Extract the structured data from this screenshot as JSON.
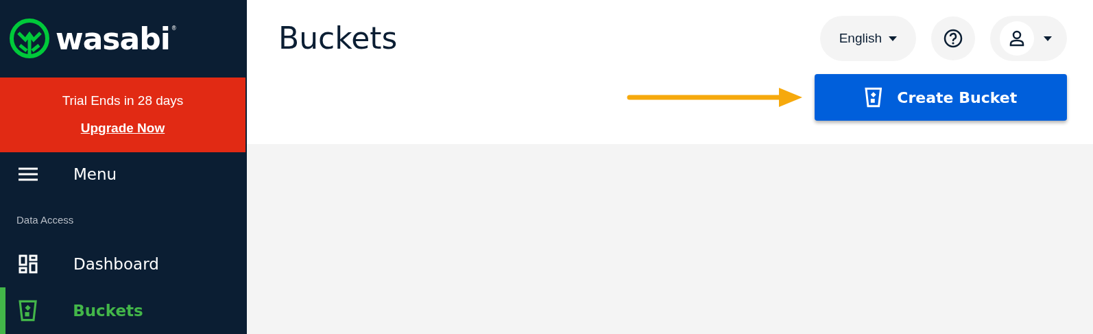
{
  "sidebar": {
    "logo": {
      "name": "wasabi",
      "mark": "®"
    },
    "trial_banner": {
      "message": "Trial Ends in 28 days",
      "link": "Upgrade Now"
    },
    "menu_label": "Menu",
    "section": "Data Access",
    "items": [
      {
        "label": "Dashboard",
        "kind": "dashboard",
        "selected": false
      },
      {
        "label": "Buckets",
        "kind": "bucket",
        "selected": true
      }
    ]
  },
  "header": {
    "title": "Buckets",
    "language": "English",
    "create_button": "Create Bucket"
  }
}
